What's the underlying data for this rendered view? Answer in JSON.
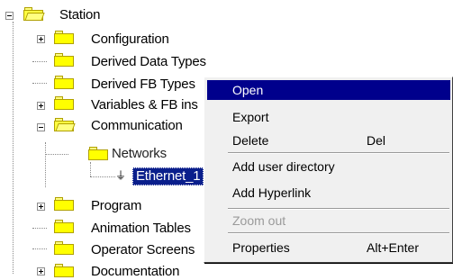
{
  "tree": {
    "root": {
      "label": "Station",
      "expander": "-"
    },
    "items": [
      {
        "label": "Configuration",
        "expander": "+"
      },
      {
        "label": "Derived Data Types",
        "expander": ""
      },
      {
        "label": "Derived FB Types",
        "expander": ""
      },
      {
        "label": "Variables & FB ins",
        "expander": "+"
      },
      {
        "label": "Communication",
        "expander": "-"
      },
      {
        "label": "Networks",
        "expander": ""
      },
      {
        "label": "Ethernet_1",
        "expander": ""
      },
      {
        "label": "Program",
        "expander": "+"
      },
      {
        "label": "Animation Tables",
        "expander": ""
      },
      {
        "label": "Operator Screens",
        "expander": ""
      },
      {
        "label": "Documentation",
        "expander": "+"
      }
    ]
  },
  "context_menu": {
    "items": [
      {
        "label": "Open",
        "shortcut": "",
        "state": "highlighted"
      },
      {
        "label": "Export",
        "shortcut": "",
        "state": "enabled"
      },
      {
        "label": "Delete",
        "shortcut": "Del",
        "state": "enabled"
      },
      {
        "label": "Add user directory",
        "shortcut": "",
        "state": "enabled"
      },
      {
        "label": "Add Hyperlink",
        "shortcut": "",
        "state": "enabled"
      },
      {
        "label": "Zoom out",
        "shortcut": "",
        "state": "disabled"
      },
      {
        "label": "Properties",
        "shortcut": "Alt+Enter",
        "state": "enabled"
      }
    ]
  },
  "colors": {
    "selection": "#0a1f8c",
    "menu_highlight": "#00008c",
    "folder": "#ffff00"
  }
}
